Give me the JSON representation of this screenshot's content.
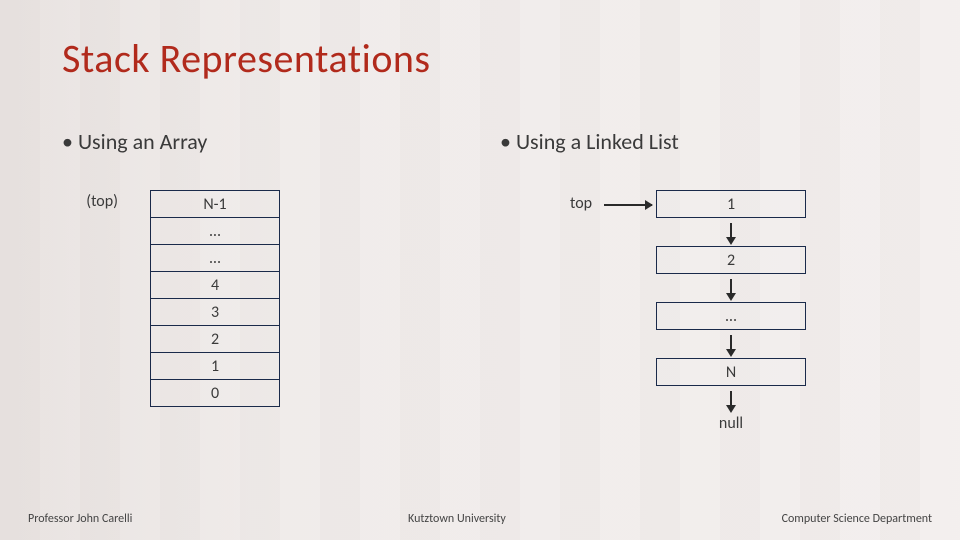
{
  "title": "Stack Representations",
  "left": {
    "bullet": "Using an Array",
    "top_label": "(top)",
    "cells": [
      "N-1",
      "…",
      "…",
      "4",
      "3",
      "2",
      "1",
      "0"
    ]
  },
  "right": {
    "bullet": "Using a Linked List",
    "top_label": "top",
    "nodes": [
      "1",
      "2",
      "…",
      "N"
    ],
    "null_label": "null"
  },
  "footer": {
    "left": "Professor John Carelli",
    "center": "Kutztown University",
    "right": "Computer Science Department"
  }
}
